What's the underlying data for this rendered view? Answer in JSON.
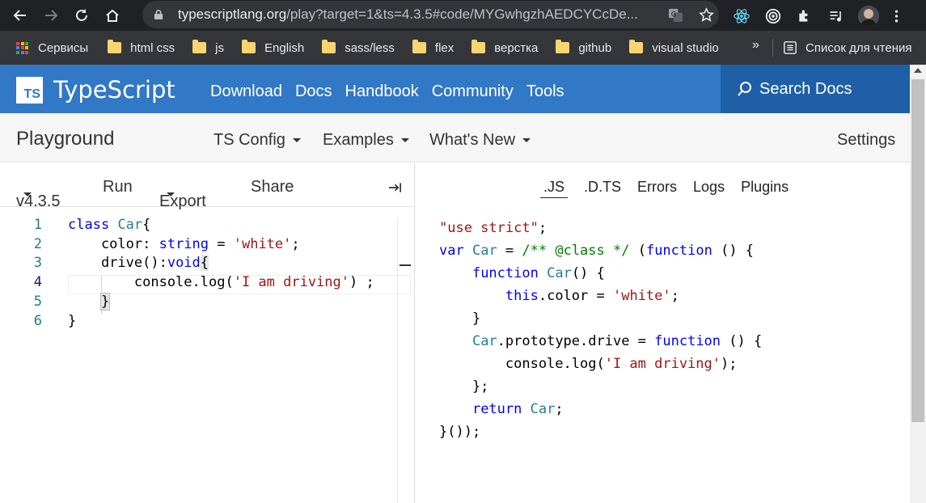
{
  "browser": {
    "url_host": "typescriptlang.org",
    "url_path": "/play?target=1&ts=4.3.5#code/MYGwhgzhAEDCYCcDe...",
    "bookmarks": [
      {
        "label": "Сервисы",
        "icon": "apps-grid-icon"
      },
      {
        "label": "html css",
        "icon": "folder-icon"
      },
      {
        "label": "js",
        "icon": "folder-icon"
      },
      {
        "label": "English",
        "icon": "folder-icon"
      },
      {
        "label": "sass/less",
        "icon": "folder-icon"
      },
      {
        "label": "flex",
        "icon": "folder-icon"
      },
      {
        "label": "верстка",
        "icon": "folder-icon"
      },
      {
        "label": "github",
        "icon": "folder-icon"
      },
      {
        "label": "visual studio",
        "icon": "folder-icon"
      }
    ],
    "more": "»",
    "reading_list": "Список для чтения"
  },
  "header": {
    "brand": "TypeScript",
    "logo_text": "TS",
    "nav": [
      "Download",
      "Docs",
      "Handbook",
      "Community",
      "Tools"
    ],
    "search": "Search Docs"
  },
  "playground": {
    "title": "Playground",
    "menus": [
      "TS Config",
      "Examples",
      "What's New"
    ],
    "settings": "Settings"
  },
  "toolbar": {
    "version": "v4.3.5",
    "run": "Run",
    "export": "Export",
    "share": "Share"
  },
  "output_tabs": [
    ".JS",
    ".D.TS",
    "Errors",
    "Logs",
    "Plugins"
  ],
  "editor_lines": [
    "1",
    "2",
    "3",
    "4",
    "5",
    "6"
  ],
  "colors": {
    "brand_blue": "#3178c6",
    "search_blue": "#1e5fa8",
    "keyword": "#0000ff",
    "string": "#a31515",
    "type": "#267f99",
    "comment": "#008000"
  }
}
